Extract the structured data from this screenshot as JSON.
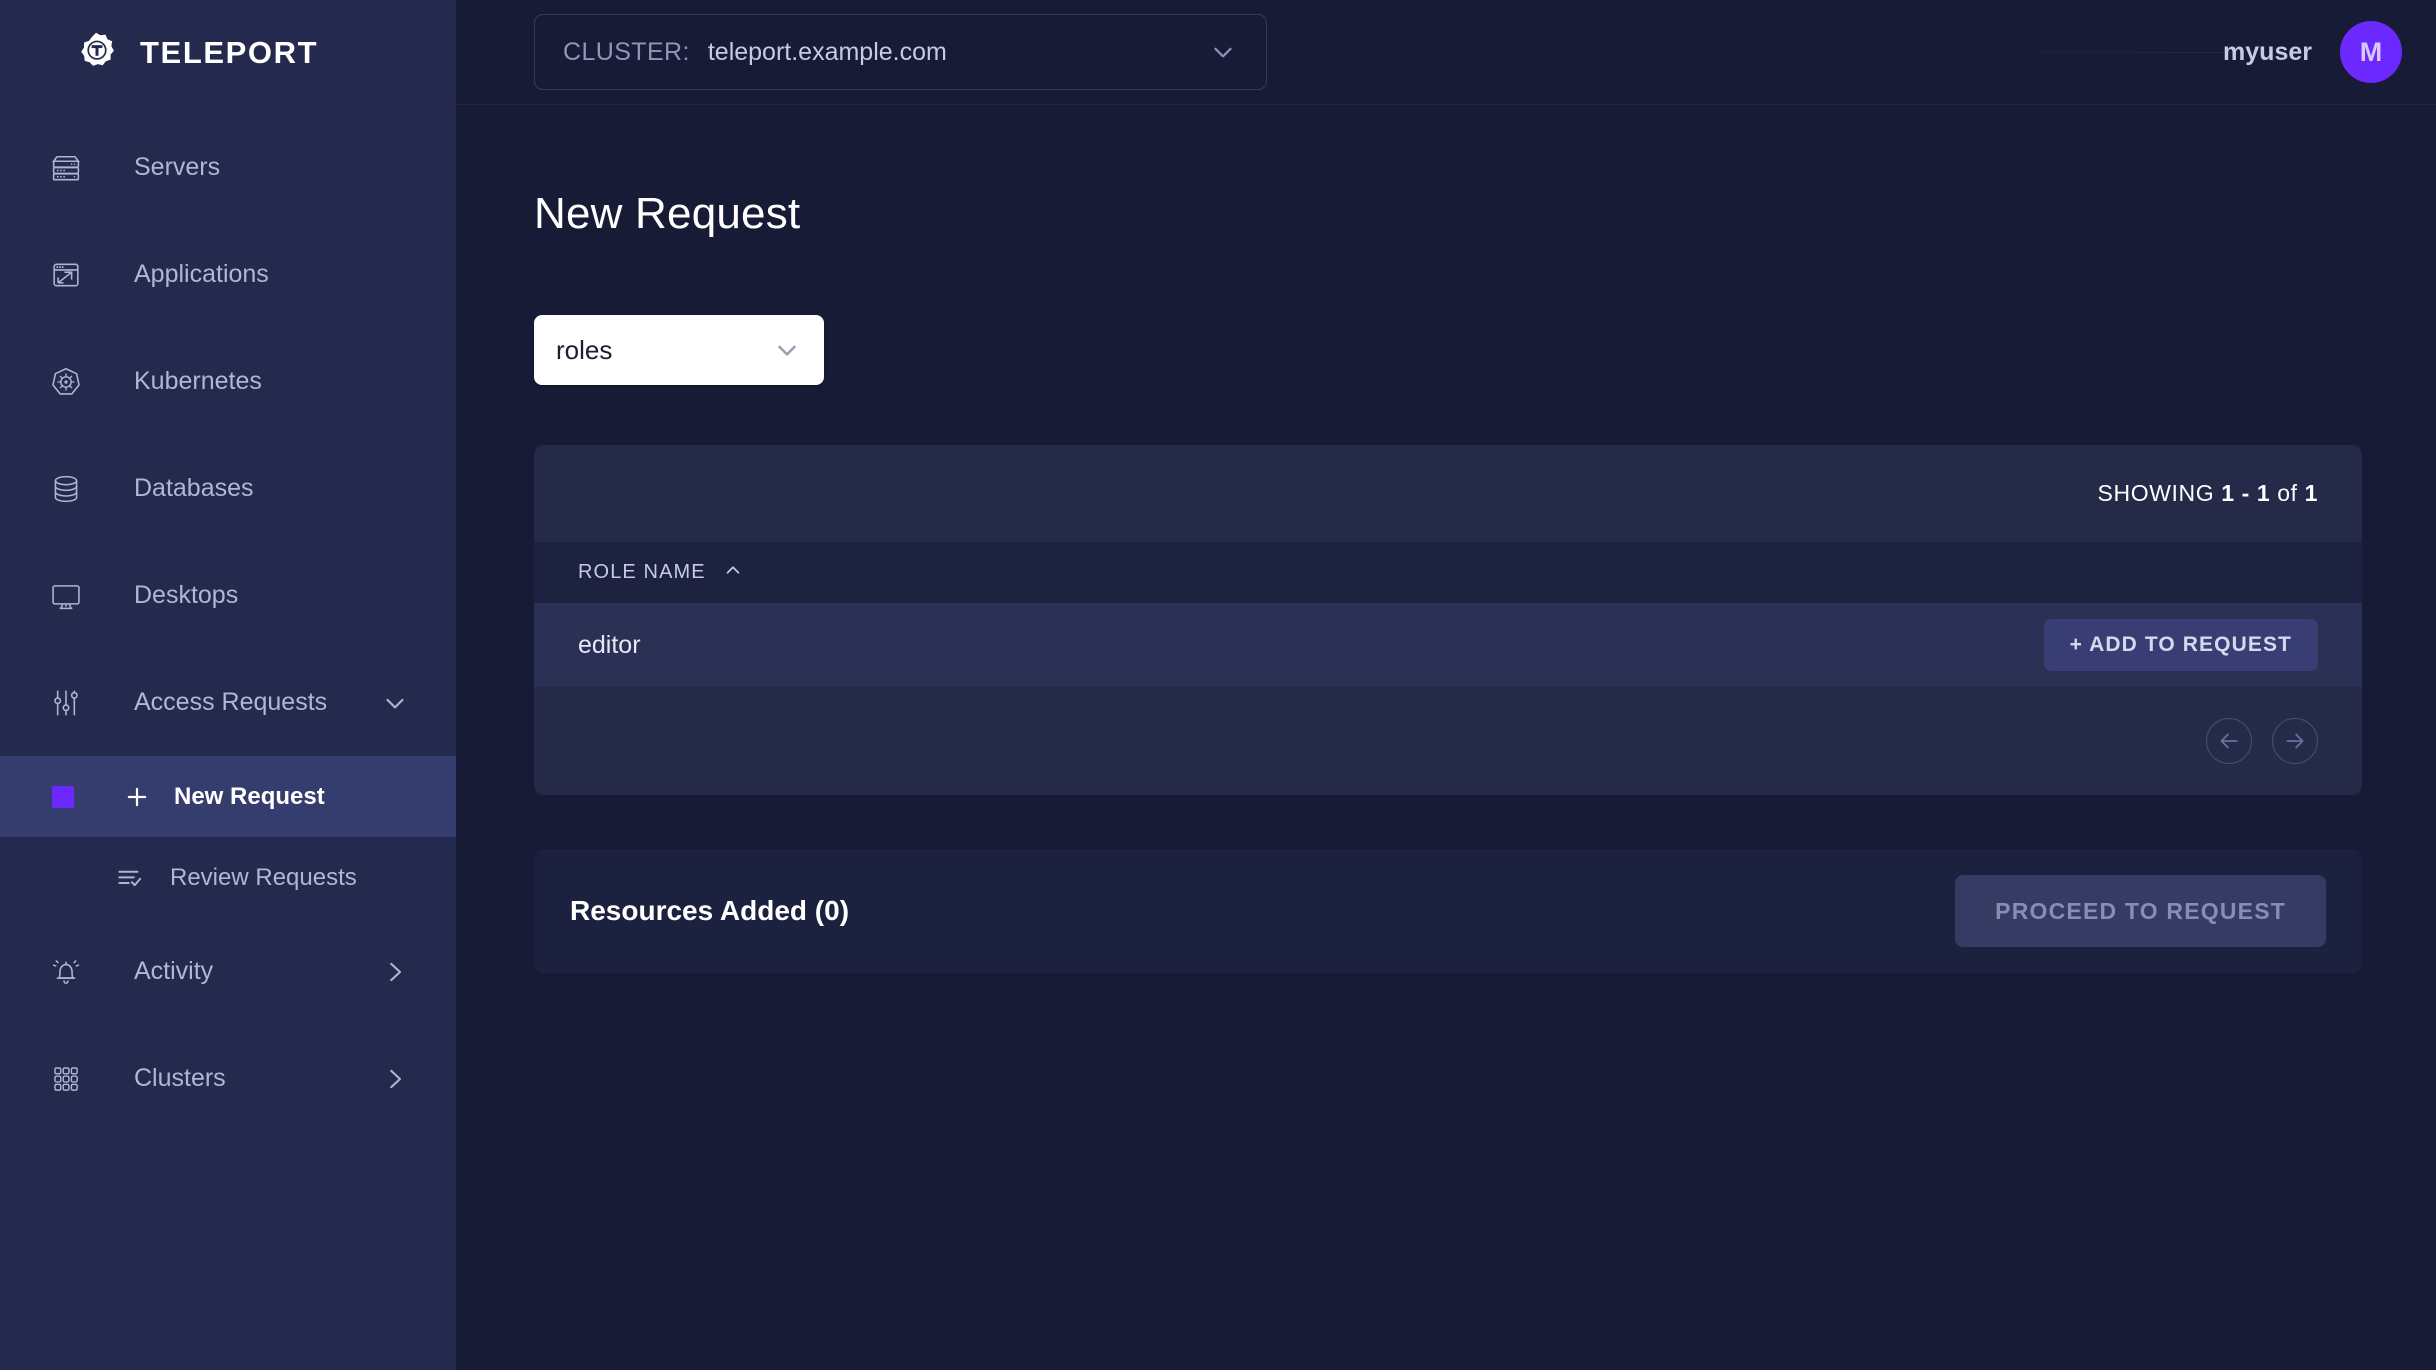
{
  "brand": {
    "name": "TELEPORT",
    "logo_icon": "teleport-gear-logo"
  },
  "sidebar": {
    "items": [
      {
        "label": "Servers",
        "icon": "server-rack-icon"
      },
      {
        "label": "Applications",
        "icon": "application-window-icon"
      },
      {
        "label": "Kubernetes",
        "icon": "kubernetes-helm-icon"
      },
      {
        "label": "Databases",
        "icon": "database-cylinder-icon"
      },
      {
        "label": "Desktops",
        "icon": "desktop-monitor-icon"
      }
    ],
    "access_requests": {
      "label": "Access Requests",
      "icon": "sliders-icon",
      "chevron": "chevron-down-icon",
      "sub_items": [
        {
          "label": "New Request",
          "icon": "plus-icon",
          "active": true
        },
        {
          "label": "Review Requests",
          "icon": "list-check-icon",
          "active": false
        }
      ]
    },
    "activity": {
      "label": "Activity",
      "icon": "bell-ringing-icon",
      "chevron": "chevron-right-icon"
    },
    "clusters": {
      "label": "Clusters",
      "icon": "grid-3x3-icon",
      "chevron": "chevron-right-icon"
    }
  },
  "topbar": {
    "cluster_label": "CLUSTER:",
    "cluster_value": "teleport.example.com",
    "cluster_chevron": "chevron-down-icon",
    "username": "myuser",
    "avatar_initial": "M"
  },
  "page": {
    "title": "New Request",
    "kind_select": {
      "value": "roles",
      "chevron": "chevron-down-icon"
    }
  },
  "results": {
    "showing_prefix": "SHOWING ",
    "showing_range": "1 - 1",
    "showing_mid": " of ",
    "showing_total": "1",
    "columns": [
      {
        "label": "ROLE NAME",
        "sort": "ascending",
        "sort_icon": "chevron-up-icon"
      }
    ],
    "rows": [
      {
        "role_name": "editor",
        "action_label": "+ ADD TO REQUEST"
      }
    ],
    "pagination": {
      "prev_icon": "arrow-left-circle-icon",
      "next_icon": "arrow-right-circle-icon"
    }
  },
  "resources_added": {
    "title": "Resources Added (0)",
    "proceed_label": "PROCEED TO REQUEST"
  },
  "colors": {
    "accent": "#6c29ff",
    "sidebar_bg": "#242a4d",
    "main_bg": "#181b35",
    "card_bg": "#252a49",
    "row_bg": "#2b3055",
    "text_primary": "#ffffff",
    "text_muted": "#b0b6d4"
  }
}
